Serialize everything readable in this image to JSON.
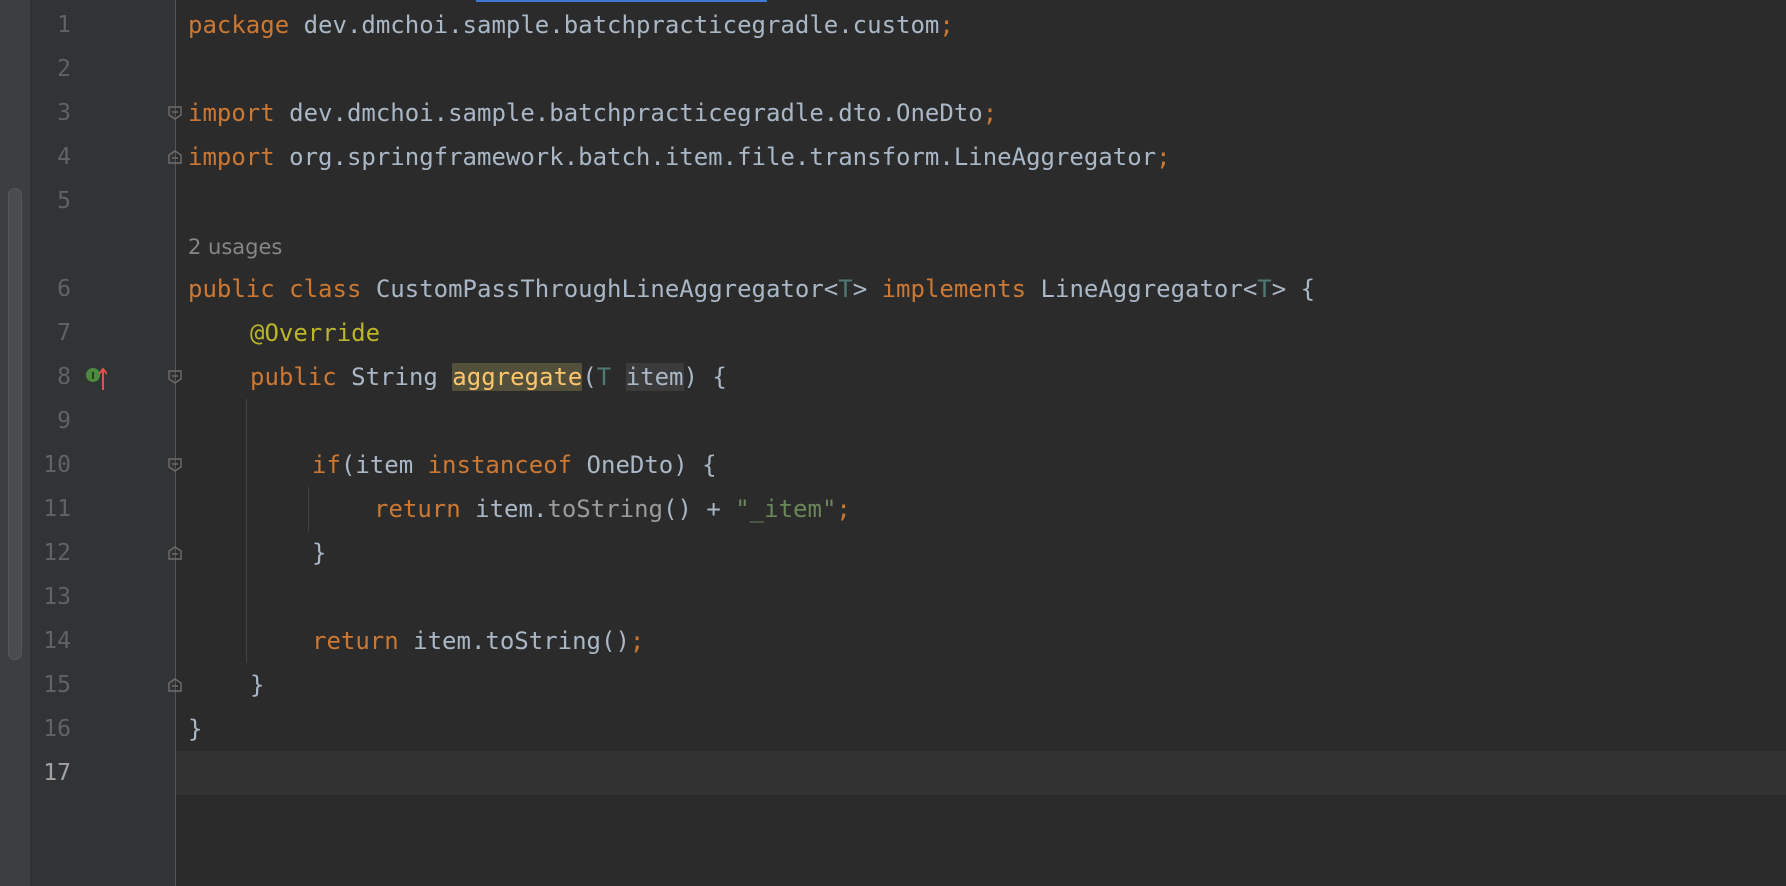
{
  "editor": {
    "line_numbers": [
      "1",
      "2",
      "3",
      "4",
      "5",
      "6",
      "7",
      "8",
      "9",
      "10",
      "11",
      "12",
      "13",
      "14",
      "15",
      "16",
      "17"
    ],
    "usages_hint": "2 usages",
    "lines": {
      "l1": {
        "kw_package": "package",
        "pkg_name": " dev.dmchoi.sample.batchpracticegradle.custom",
        "semi": ";"
      },
      "l3": {
        "kw_import": "import",
        "path": " dev.dmchoi.sample.batchpracticegradle.dto.OneDto",
        "semi": ";"
      },
      "l4": {
        "kw_import": "import",
        "path": " org.springframework.batch.item.file.transform.LineAggregator",
        "semi": ";"
      },
      "l6": {
        "kw_public": "public",
        "kw_class": " class",
        "class_name": " CustomPassThroughLineAggregator<",
        "tp1": "T",
        "gt1": "> ",
        "kw_implements": "implements",
        "iface": " LineAggregator<",
        "tp2": "T",
        "rest": "> {"
      },
      "l7": {
        "annotation": "@Override"
      },
      "l8": {
        "kw_public": "public",
        "ret_type": " String ",
        "method": "aggregate",
        "paren": "(",
        "tp": "T",
        "sp": " ",
        "param": "item",
        "rest": ") {"
      },
      "l10": {
        "kw_if": "if",
        "cond_open": "(item ",
        "kw_instanceof": "instanceof",
        "cond_rest": " OneDto) {"
      },
      "l11": {
        "kw_return": "return",
        "obj": " item.",
        "method": "toString",
        "op": "() + ",
        "str": "\"_item\"",
        "semi": ";"
      },
      "l12": {
        "brace": "}"
      },
      "l14": {
        "kw_return": "return",
        "expr": " item.toString()",
        "semi": ";"
      },
      "l15": {
        "brace": "}"
      },
      "l16": {
        "brace": "}"
      }
    },
    "current_line": "17"
  },
  "icons": {
    "override": "implements-method-gutter-icon",
    "fold": "fold-marker-icon"
  },
  "colors": {
    "background": "#2b2b2b",
    "gutter": "#313335",
    "keyword": "#cc7832",
    "plain": "#a9b7c6",
    "type_param": "#507874",
    "annotation": "#bbb529",
    "string": "#6a8759",
    "method_highlight": "#ffc66d",
    "line_number": "#606366"
  }
}
